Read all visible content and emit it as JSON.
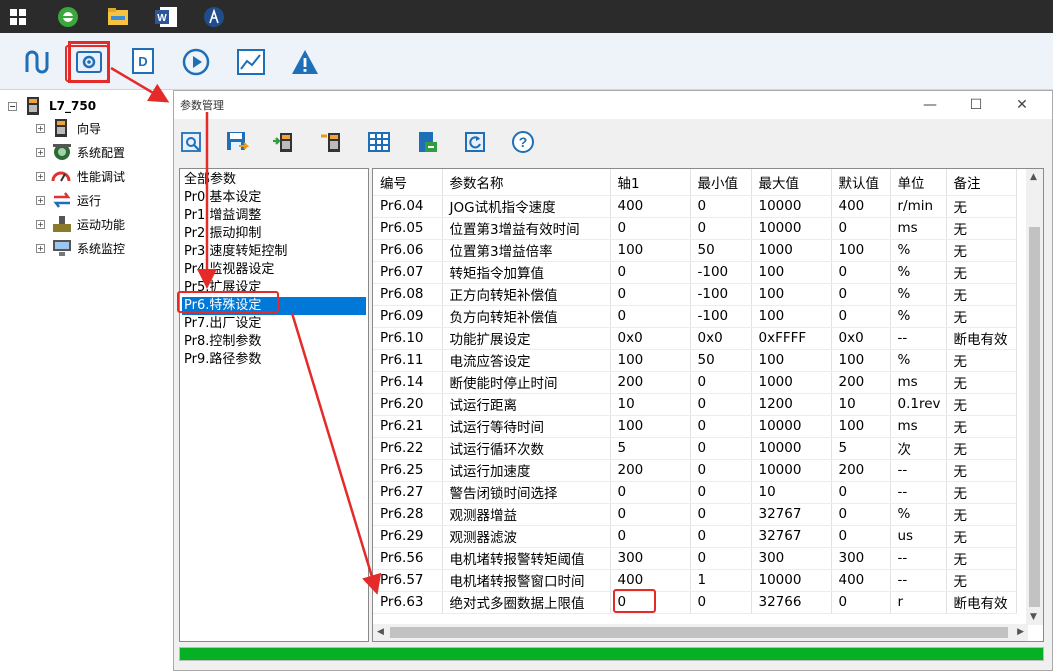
{
  "taskbar": {
    "icons": [
      "windows-start-icon",
      "browser-icon",
      "file-explorer-icon",
      "word-icon",
      "app-icon"
    ],
    "word_letter": "W"
  },
  "app_toolbar": {
    "tools": [
      "connect-icon",
      "parameter-settings-icon",
      "document-icon",
      "run-icon",
      "monitor-chart-icon",
      "alarm-icon"
    ],
    "document_letter": "D"
  },
  "tree": {
    "root": "L7_750",
    "items": [
      "向导",
      "系统配置",
      "性能调试",
      "运行",
      "运动功能",
      "系统监控"
    ],
    "expander": "+",
    "root_expander": "−"
  },
  "dialog": {
    "title": "参数管理",
    "controls": {
      "minimize": "—",
      "maximize": "☐",
      "close": "✕"
    },
    "toolbar_icons": [
      "search-params-icon",
      "save-icon",
      "upload-icon",
      "download-icon",
      "grid-icon",
      "export-icon",
      "reset-icon",
      "help-icon"
    ],
    "help_glyph": "?"
  },
  "categories": {
    "items": [
      "全部参数",
      "Pr0.基本设定",
      "Pr1.增益调整",
      "Pr2.振动抑制",
      "Pr3.速度转矩控制",
      "Pr4.监视器设定",
      "Pr5.扩展设定",
      "Pr6.特殊设定",
      "Pr7.出厂设定",
      "Pr8.控制参数",
      "Pr9.路径参数"
    ],
    "selected": "Pr6.特殊设定"
  },
  "table": {
    "headers": [
      "编号",
      "参数名称",
      "轴1",
      "最小值",
      "最大值",
      "默认值",
      "单位",
      "备注"
    ],
    "rows": [
      [
        "Pr6.04",
        "JOG试机指令速度",
        "400",
        "0",
        "10000",
        "400",
        "r/min",
        "无"
      ],
      [
        "Pr6.05",
        "位置第3增益有效时间",
        "0",
        "0",
        "10000",
        "0",
        "ms",
        "无"
      ],
      [
        "Pr6.06",
        "位置第3增益倍率",
        "100",
        "50",
        "1000",
        "100",
        "%",
        "无"
      ],
      [
        "Pr6.07",
        "转矩指令加算值",
        "0",
        "-100",
        "100",
        "0",
        "%",
        "无"
      ],
      [
        "Pr6.08",
        "正方向转矩补偿值",
        "0",
        "-100",
        "100",
        "0",
        "%",
        "无"
      ],
      [
        "Pr6.09",
        "负方向转矩补偿值",
        "0",
        "-100",
        "100",
        "0",
        "%",
        "无"
      ],
      [
        "Pr6.10",
        "功能扩展设定",
        "0x0",
        "0x0",
        "0xFFFF",
        "0x0",
        "--",
        "断电有效"
      ],
      [
        "Pr6.11",
        "电流应答设定",
        "100",
        "50",
        "100",
        "100",
        "%",
        "无"
      ],
      [
        "Pr6.14",
        "断使能时停止时间",
        "200",
        "0",
        "1000",
        "200",
        "ms",
        "无"
      ],
      [
        "Pr6.20",
        "试运行距离",
        "10",
        "0",
        "1200",
        "10",
        "0.1rev",
        "无"
      ],
      [
        "Pr6.21",
        "试运行等待时间",
        "100",
        "0",
        "10000",
        "100",
        "ms",
        "无"
      ],
      [
        "Pr6.22",
        "试运行循环次数",
        "5",
        "0",
        "10000",
        "5",
        "次",
        "无"
      ],
      [
        "Pr6.25",
        "试运行加速度",
        "200",
        "0",
        "10000",
        "200",
        "--",
        "无"
      ],
      [
        "Pr6.27",
        "警告闭锁时间选择",
        "0",
        "0",
        "10",
        "0",
        "--",
        "无"
      ],
      [
        "Pr6.28",
        "观测器增益",
        "0",
        "0",
        "32767",
        "0",
        "%",
        "无"
      ],
      [
        "Pr6.29",
        "观测器滤波",
        "0",
        "0",
        "32767",
        "0",
        "us",
        "无"
      ],
      [
        "Pr6.56",
        "电机堵转报警转矩阈值",
        "300",
        "0",
        "300",
        "300",
        "--",
        "无"
      ],
      [
        "Pr6.57",
        "电机堵转报警窗口时间",
        "400",
        "1",
        "10000",
        "400",
        "--",
        "无"
      ],
      [
        "Pr6.63",
        "绝对式多圈数据上限值",
        "0",
        "0",
        "32766",
        "0",
        "r",
        "断电有效"
      ]
    ],
    "highlighted_cell": "Pr6.63 轴1",
    "scroll_up": "▲",
    "scroll_down": "▼",
    "scroll_left": "◀",
    "scroll_right": "▶"
  },
  "progress": {
    "value": 1.0
  },
  "colors": {
    "accent": "#0078d7",
    "highlight": "#e52a2a",
    "progress": "#06b025"
  }
}
